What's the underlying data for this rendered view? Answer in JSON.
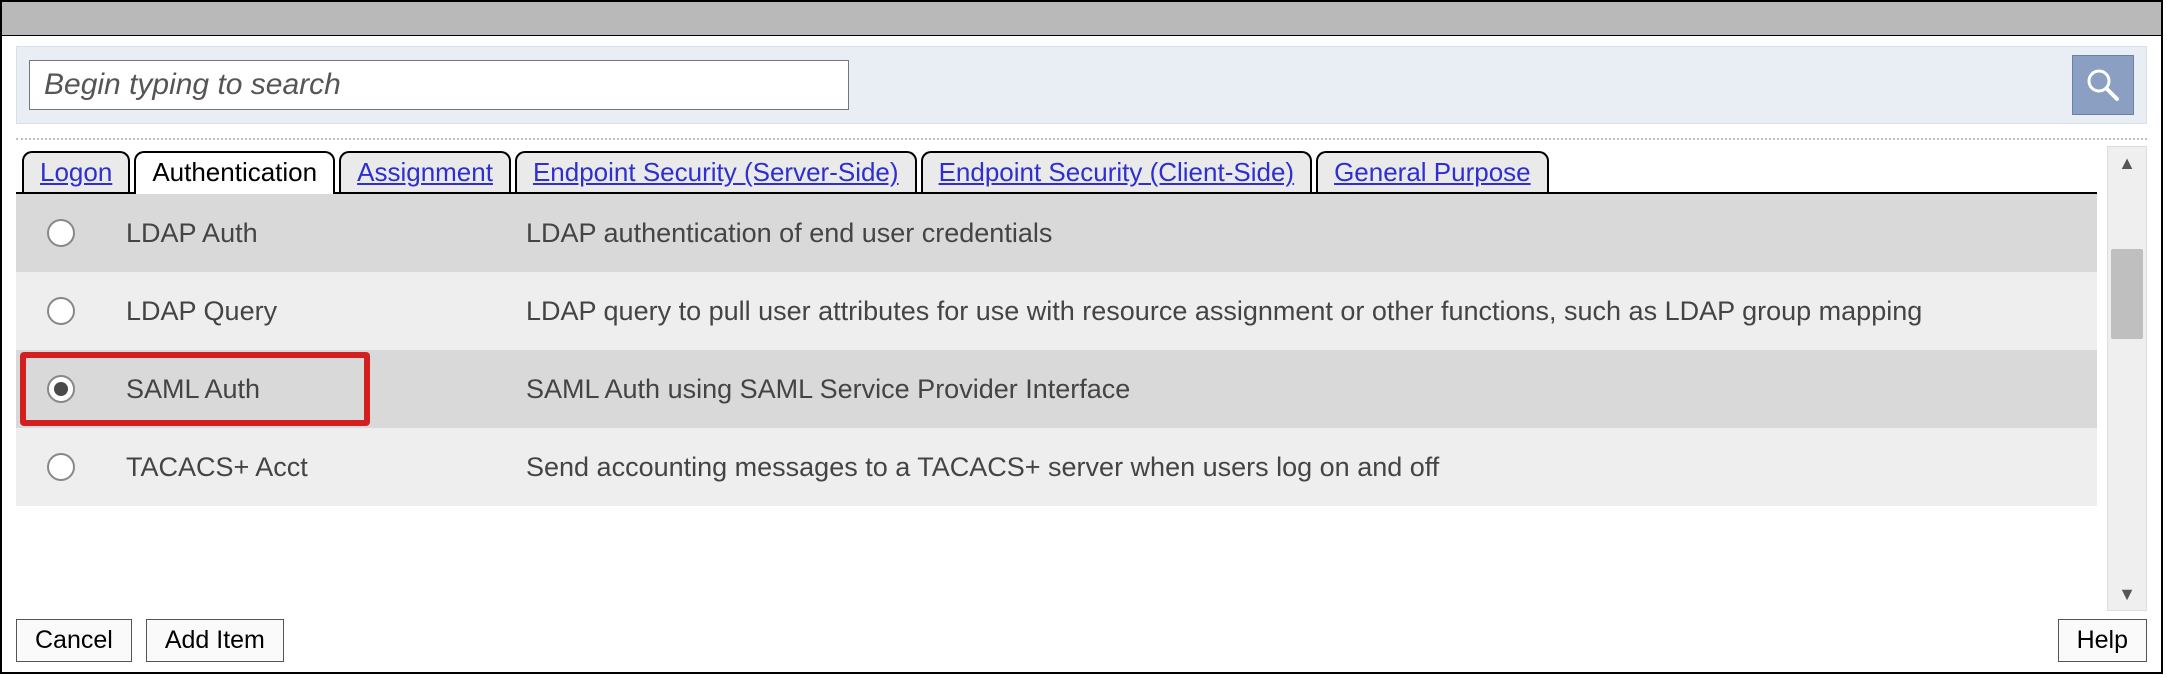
{
  "search": {
    "placeholder": "Begin typing to search"
  },
  "tabs": [
    {
      "label": "Logon",
      "active": false
    },
    {
      "label": "Authentication",
      "active": true
    },
    {
      "label": "Assignment",
      "active": false
    },
    {
      "label": "Endpoint Security (Server-Side)",
      "active": false
    },
    {
      "label": "Endpoint Security (Client-Side)",
      "active": false
    },
    {
      "label": "General Purpose",
      "active": false
    }
  ],
  "rows": [
    {
      "name": "LDAP Auth",
      "desc": "LDAP authentication of end user credentials",
      "selected": false
    },
    {
      "name": "LDAP Query",
      "desc": "LDAP query to pull user attributes for use with resource assignment or other functions, such as LDAP group mapping",
      "selected": false
    },
    {
      "name": "SAML Auth",
      "desc": "SAML Auth using SAML Service Provider Interface",
      "selected": true,
      "highlighted": true
    },
    {
      "name": "TACACS+ Acct",
      "desc": "Send accounting messages to a TACACS+ server when users log on and off",
      "selected": false
    }
  ],
  "buttons": {
    "cancel": "Cancel",
    "add": "Add Item",
    "help": "Help"
  }
}
